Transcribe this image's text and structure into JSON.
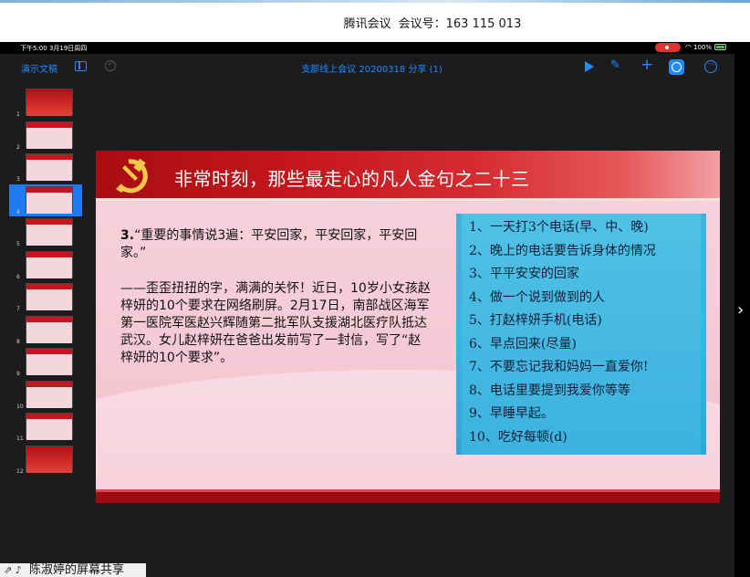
{
  "meeting": {
    "app_name": "腾讯会议",
    "meeting_id_label": "会议号：163 115 013"
  },
  "status_bar": {
    "time_date": "下午5:00  3月19日周四",
    "battery": "100%"
  },
  "toolbar": {
    "docs_button": "演示文稿",
    "document_title": "支部线上会议 20200318 分享 (1)"
  },
  "navigator": {
    "slides": [
      {
        "num": "1",
        "style": "red"
      },
      {
        "num": "2",
        "style": "pink"
      },
      {
        "num": "3",
        "style": "pink"
      },
      {
        "num": "4",
        "style": "pink",
        "selected": true
      },
      {
        "num": "5",
        "style": "pink"
      },
      {
        "num": "6",
        "style": "pink"
      },
      {
        "num": "7",
        "style": "pink"
      },
      {
        "num": "8",
        "style": "pink"
      },
      {
        "num": "9",
        "style": "pink"
      },
      {
        "num": "10",
        "style": "pink"
      },
      {
        "num": "11",
        "style": "pink"
      },
      {
        "num": "12",
        "style": "red"
      }
    ]
  },
  "slide": {
    "heading": "非常时刻，那些最走心的凡人金句之二十三",
    "line1_number": "3.",
    "line1_text": "“重要的事情说3遍：平安回家，平安回家，平安回家。”",
    "paragraph": "——歪歪扭扭的字，满满的关怀！近日，10岁小女孩赵梓妍的10个要求在网络刷屏。2月17日，南部战区海军第一医院军医赵兴辉随第二批军队支援湖北医疗队抵达武汉。女儿赵梓妍在爸爸出发前写了一封信，写了“赵梓妍的10个要求”。",
    "handwritten_note": [
      "1、一天打3个电话(早、中、晚)",
      "2、晚上的电话要告诉身体的情况",
      "3、平平安安的回家",
      "4、做一个说到做到的人",
      "5、打赵梓妍手机(电话)",
      "6、早点回来(尽量)",
      "7、不要忘记我和妈妈一直爱你!",
      "8、电话里要提到我爱你等等",
      "9、早睡早起。",
      "10、吃好每顿(d)"
    ]
  },
  "share": {
    "label": "陈淑婷的屏幕共享"
  },
  "colors": {
    "accent_blue": "#1e8cff",
    "slide_red": "#c3161c",
    "record_red": "#e0352f"
  },
  "icons": [
    "play-icon",
    "brush-icon",
    "plus-icon",
    "collaborate-icon",
    "more-icon",
    "sidebar-icon",
    "undo-icon",
    "wifi-icon",
    "battery-icon",
    "chevron-right-icon",
    "microphone-icon",
    "party-emblem-icon"
  ]
}
